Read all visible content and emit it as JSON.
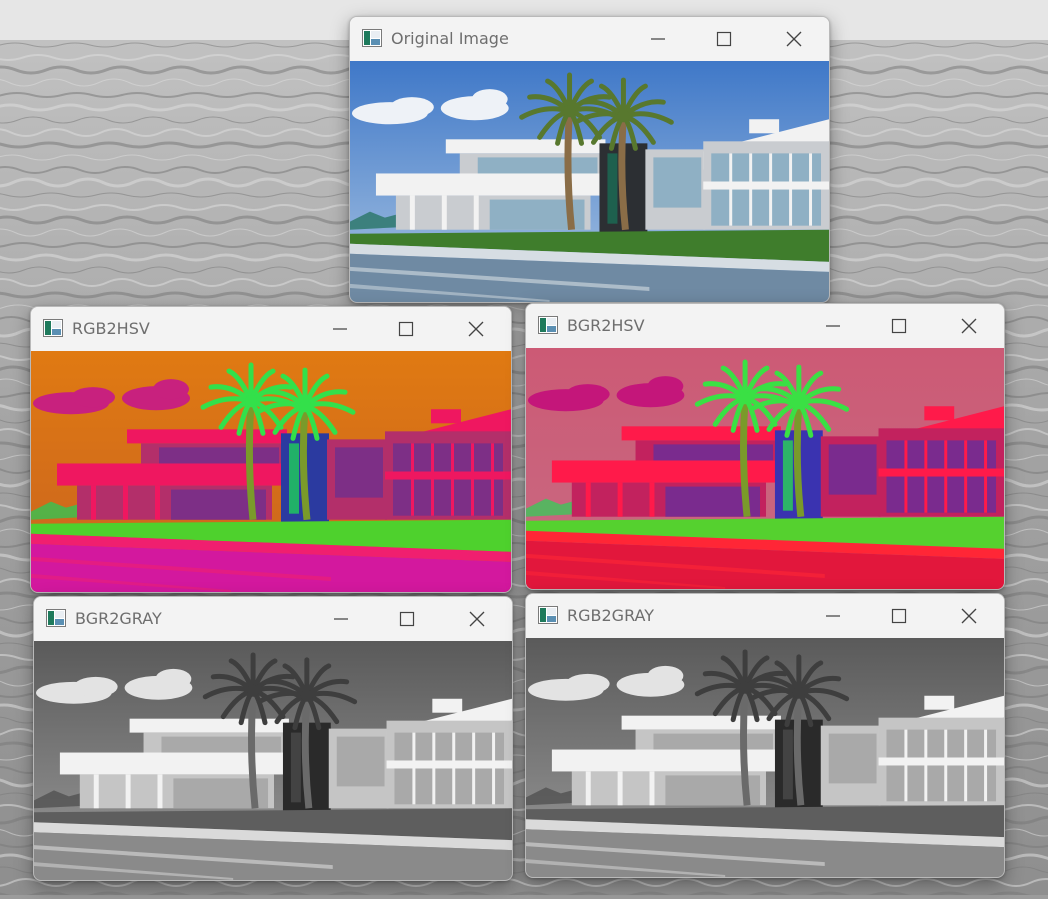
{
  "windows": [
    {
      "title": "Original Image",
      "icon": "opencv-window-icon",
      "mode": "original"
    },
    {
      "title": "RGB2HSV",
      "icon": "opencv-window-icon",
      "mode": "hsv_a"
    },
    {
      "title": "BGR2HSV",
      "icon": "opencv-window-icon",
      "mode": "hsv_b"
    },
    {
      "title": "BGR2GRAY",
      "icon": "opencv-window-icon",
      "mode": "gray"
    },
    {
      "title": "RGB2GRAY",
      "icon": "opencv-window-icon",
      "mode": "gray"
    }
  ],
  "window_controls": {
    "minimize": "minimize-icon",
    "maximize": "maximize-icon",
    "close": "close-icon"
  },
  "palettes": {
    "original": {
      "sky": "#3f78c8",
      "skyHorizon": "#a9c4e2",
      "cloud": "#eef2f7",
      "house": "#f2f2f2",
      "shade": "#c9ccd0",
      "glass": "#8fb0c4",
      "dark": "#2c2f33",
      "grass": "#3f7d2c",
      "pool": "#6f8aa3",
      "poolLine": "#d6dde3",
      "trunk": "#8a6d47",
      "palm": "#58782e",
      "accent": "#1c6d55"
    },
    "hsv_a": {
      "sky": "#e07a12",
      "skyHorizon": "#c96320",
      "cloud": "#c8217e",
      "house": "#ef1760",
      "shade": "#b32f6a",
      "glass": "#7d2f86",
      "dark": "#2b3aa0",
      "grass": "#4ed12d",
      "pool": "#d3189e",
      "poolLine": "#f01f6f",
      "trunk": "#7a9a2a",
      "palm": "#33e04a",
      "accent": "#1fd05a"
    },
    "hsv_b": {
      "sky": "#cc5a75",
      "skyHorizon": "#c86a82",
      "cloud": "#c4167a",
      "house": "#ff1a4a",
      "shade": "#c2225e",
      "glass": "#7a2b8e",
      "dark": "#3a33b0",
      "grass": "#55d12f",
      "pool": "#e2173c",
      "poolLine": "#ff2636",
      "trunk": "#7a9a2a",
      "palm": "#3ae044",
      "accent": "#2ad456"
    },
    "gray": {
      "sky": "#5a5a5a",
      "skyHorizon": "#9a9a9a",
      "cloud": "#e3e3e3",
      "house": "#f2f2f2",
      "shade": "#c5c5c5",
      "glass": "#a9a9a9",
      "dark": "#2a2a2a",
      "grass": "#5e5e5e",
      "pool": "#8a8a8a",
      "poolLine": "#dadada",
      "trunk": "#6a6a6a",
      "palm": "#3e3e3e",
      "accent": "#4a4a4a"
    }
  }
}
